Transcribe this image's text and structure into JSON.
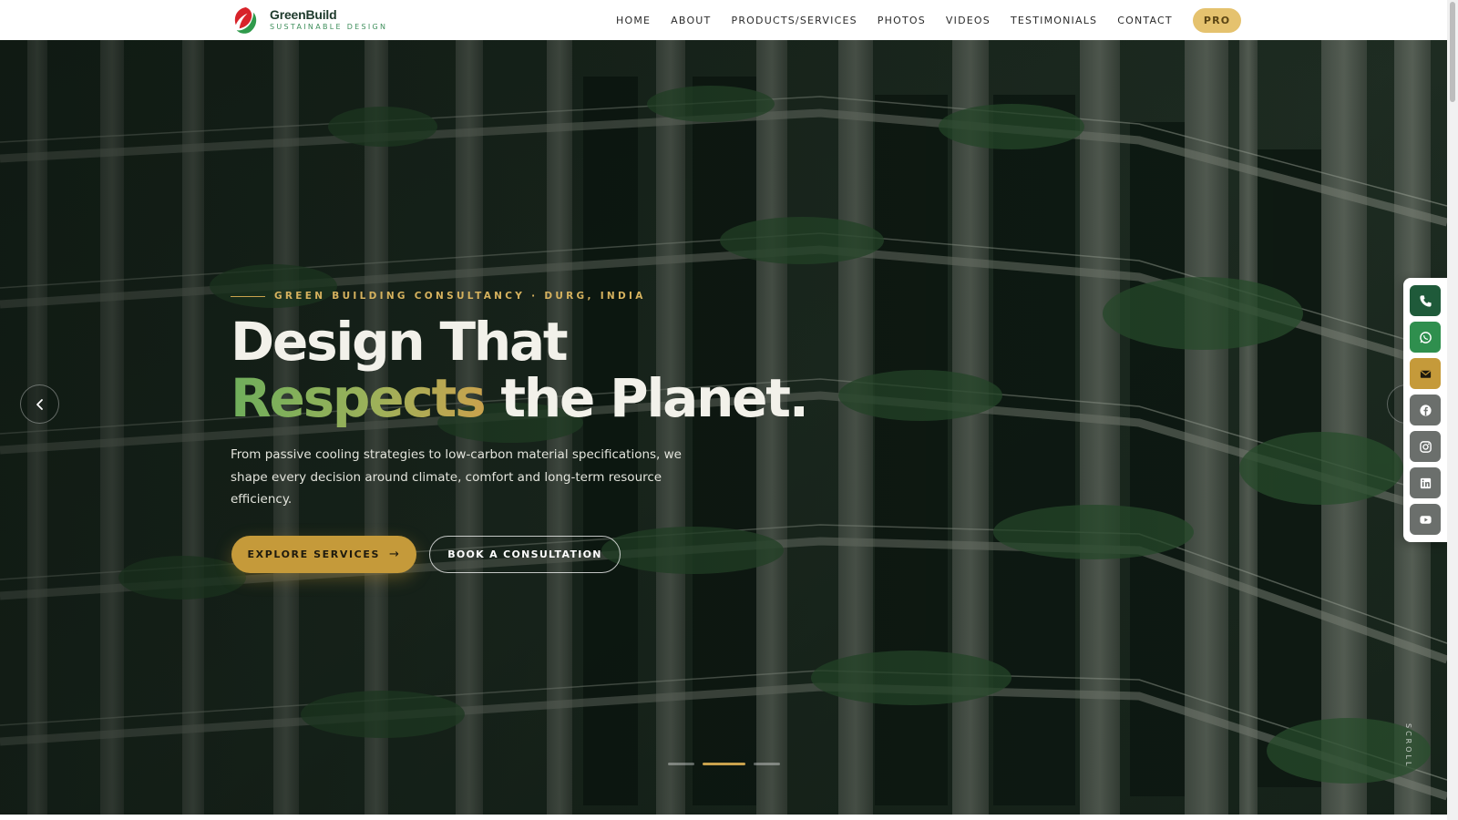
{
  "brand": {
    "name": "GreenBuild",
    "tagline": "SUSTAINABLE DESIGN"
  },
  "nav": {
    "items": [
      "HOME",
      "ABOUT",
      "PRODUCTS/SERVICES",
      "PHOTOS",
      "VIDEOS",
      "TESTIMONIALS",
      "CONTACT"
    ],
    "pro_label": "PRO"
  },
  "hero": {
    "eyebrow": "GREEN BUILDING CONSULTANCY · DURG, INDIA",
    "headline_line1": "Design That",
    "headline_accent": "Respects",
    "headline_rest": " the Planet.",
    "subcopy": "From passive cooling strategies to low-carbon material specifications, we shape every decision around climate, comfort and long-term resource efficiency.",
    "primary_cta": "EXPLORE SERVICES",
    "primary_cta_icon": "arrow-right-icon",
    "secondary_cta": "BOOK A CONSULTATION",
    "slides": {
      "count": 3,
      "active_index": 1
    },
    "scroll_hint": "SCROLL"
  },
  "social_rail": [
    {
      "name": "phone-icon",
      "bg": "#1f5a3a"
    },
    {
      "name": "whatsapp-icon",
      "bg": "#2f8f4e"
    },
    {
      "name": "email-icon",
      "bg": "#c59a3a"
    },
    {
      "name": "facebook-icon",
      "bg": "#6b6f6c"
    },
    {
      "name": "instagram-icon",
      "bg": "#6b6f6c"
    },
    {
      "name": "linkedin-icon",
      "bg": "#6b6f6c"
    },
    {
      "name": "youtube-icon",
      "bg": "#6b6f6c"
    }
  ],
  "colors": {
    "gold": "#c59a3a",
    "green_dark": "#1e3a2c",
    "green_accent": "#6fae5b",
    "pro_bg": "#e5c26e"
  }
}
